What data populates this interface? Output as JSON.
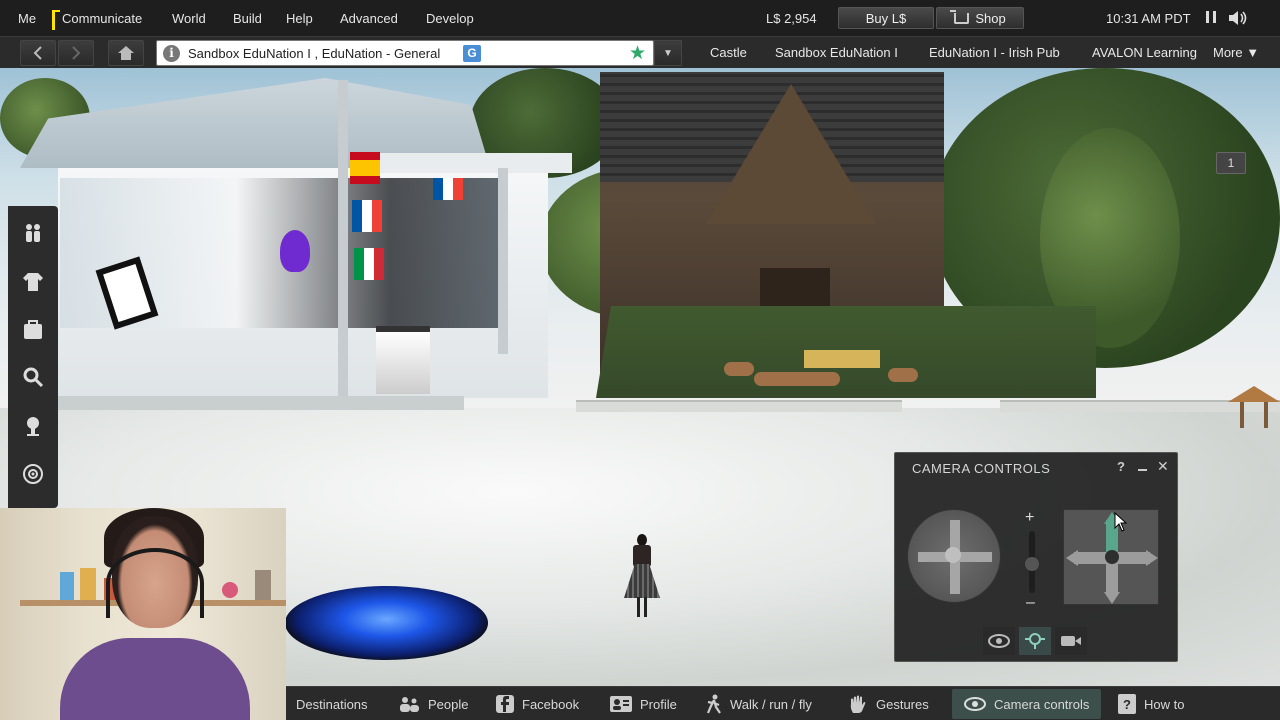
{
  "menubar": {
    "items": [
      "Me",
      "Communicate",
      "World",
      "Build",
      "Help",
      "Advanced",
      "Develop"
    ],
    "balance": "L$ 2,954",
    "buy_label": "Buy L$",
    "shop_label": "Shop",
    "clock": "10:31 AM PDT",
    "icons": [
      "pause-icon",
      "speaker-icon",
      "shopping-cart-icon"
    ]
  },
  "navbar": {
    "location": "Sandbox EduNation I , EduNation - General",
    "maturity_badge": "G",
    "favorites": [
      "Castle",
      "Sandbox EduNation I",
      "EduNation I - Irish Pub",
      "AVALON Learning"
    ],
    "more_label": "More ▼",
    "icons": [
      "back-arrow-icon",
      "forward-arrow-icon",
      "home-icon",
      "info-icon",
      "star-icon",
      "dropdown-arrow-icon"
    ]
  },
  "world": {
    "chat_count": "1"
  },
  "left_toolbar": {
    "icons": [
      "people-icon",
      "appearance-icon",
      "inventory-icon",
      "search-icon",
      "map-pin-icon",
      "radar-icon"
    ]
  },
  "camera_panel": {
    "title": "CAMERA CONTROLS",
    "help": "?",
    "close": "✕",
    "zoom_plus": "+",
    "zoom_minus": "–",
    "modes": [
      "eye-icon",
      "camera-preset-icon",
      "video-camera-icon"
    ],
    "active_mode_index": 1
  },
  "bottombar": {
    "items": [
      {
        "label": "Destinations",
        "icon": ""
      },
      {
        "label": "People",
        "icon": "people-icon"
      },
      {
        "label": "Facebook",
        "icon": "facebook-icon"
      },
      {
        "label": "Profile",
        "icon": "profile-icon"
      },
      {
        "label": "Walk / run / fly",
        "icon": "walk-icon"
      },
      {
        "label": "Gestures",
        "icon": "hand-icon"
      },
      {
        "label": "Camera controls",
        "icon": "eye-icon"
      },
      {
        "label": "How to",
        "icon": "how-to-icon"
      }
    ],
    "active_index": 6
  },
  "colors": {
    "menubar_bg": "#1e1e1e",
    "accent_active": "#3c4f4a",
    "pan_highlight": "#5aa68c",
    "maturity_badge": "#4a8fd6"
  }
}
